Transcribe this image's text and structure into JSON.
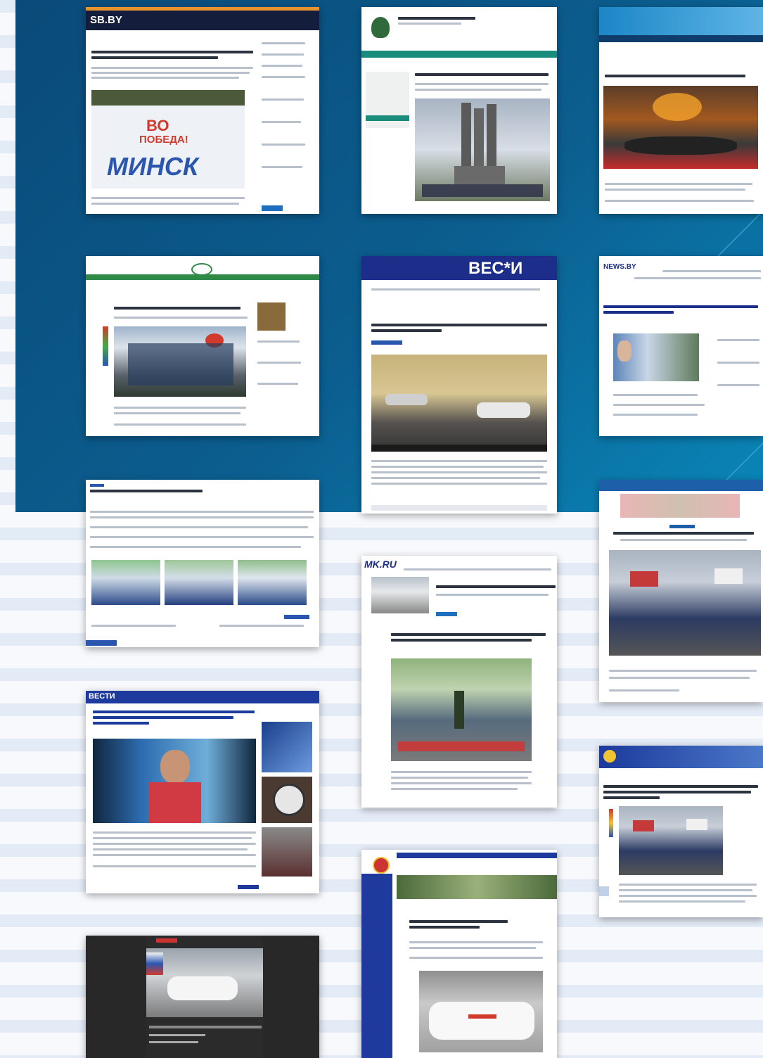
{
  "cards": {
    "sb": {
      "logo": "SB.BY",
      "city": "МИНСК",
      "slogan_line1": "ВО",
      "slogan_line2": "ПОБЕДА!"
    },
    "vesti": {
      "logo": "ВЕС*И"
    },
    "newsby": {
      "logo": "NEWS.BY"
    },
    "mk": {
      "logo": "MK.RU"
    },
    "vesti24": {
      "logo": "ВЕСТИ"
    }
  },
  "colors": {
    "background_blue": "#0b5e8f",
    "stripe": "#e3ebf6",
    "accent_red": "#d23a2c"
  }
}
